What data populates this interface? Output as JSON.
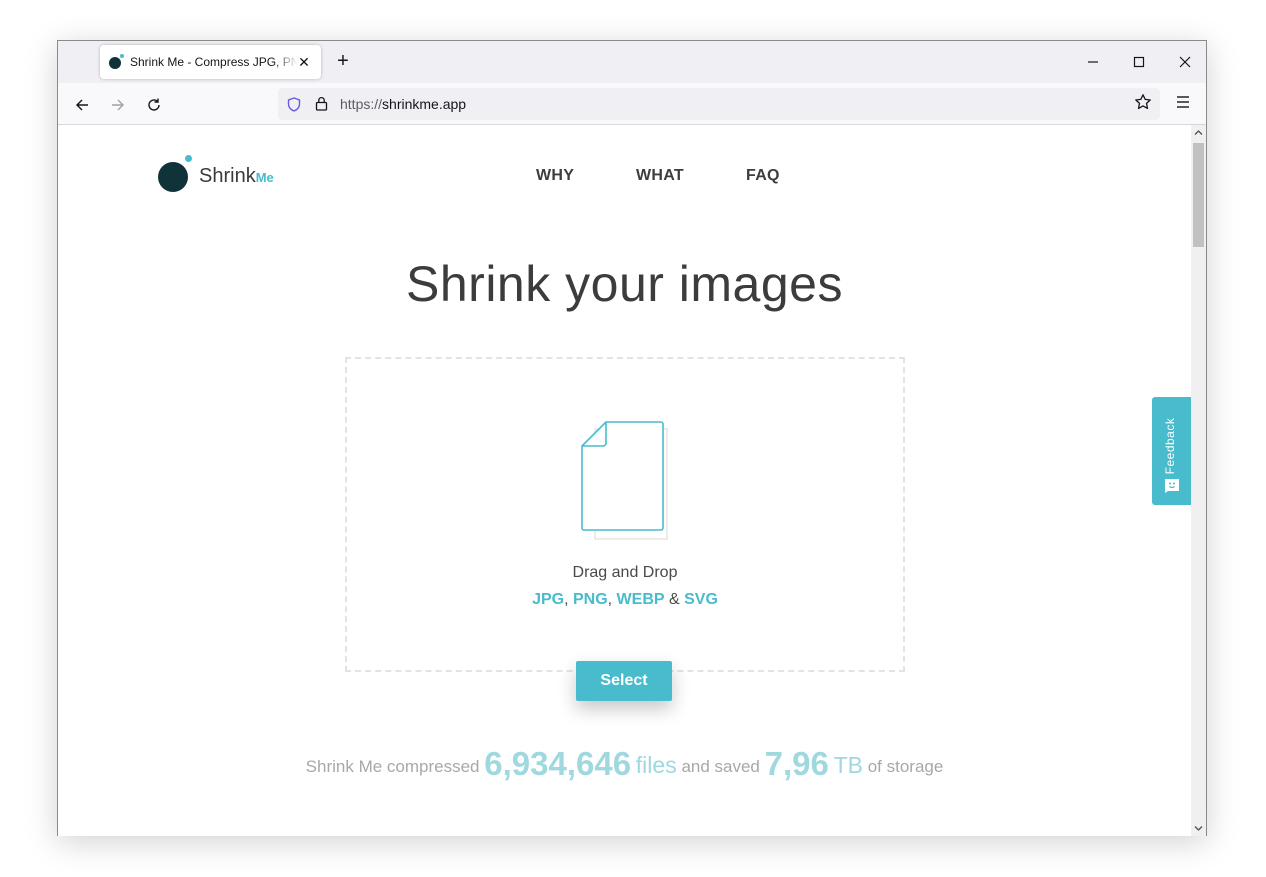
{
  "browser": {
    "tab_title": "Shrink Me - Compress JPG, PNG, WEBP & SVG",
    "url_protocol": "https://",
    "url_host": "shrinkme.app"
  },
  "page": {
    "logo_text": "Shrink",
    "logo_suffix": "Me",
    "nav": [
      "WHY",
      "WHAT",
      "FAQ"
    ],
    "hero_title": "Shrink your images",
    "drop_label": "Drag and Drop",
    "formats": [
      "JPG",
      "PNG",
      "WEBP",
      "SVG"
    ],
    "format_sep1": ", ",
    "format_sep2": ", ",
    "format_sep3": " & ",
    "select_label": "Select",
    "stats": {
      "prefix": "Shrink Me compressed",
      "files_count": "6,934,646",
      "files_unit": "files",
      "middle": "and saved",
      "storage_amount": "7,96",
      "storage_unit": "TB",
      "suffix": "of storage"
    },
    "feedback_label": "Feedback"
  },
  "colors": {
    "accent": "#48bccc",
    "logo_dark": "#0f3339",
    "stats_light": "#9fd8df"
  },
  "icons": {
    "favicon": "shrinkme-favicon",
    "close_tab": "close-icon",
    "new_tab": "plus-icon",
    "back": "back-arrow-icon",
    "forward": "forward-arrow-icon",
    "reload": "reload-icon",
    "tracking": "shield-icon",
    "secure": "lock-icon",
    "bookmark": "star-icon",
    "menu": "hamburger-menu-icon",
    "file": "file-icon",
    "feedback": "smiley-icon"
  }
}
